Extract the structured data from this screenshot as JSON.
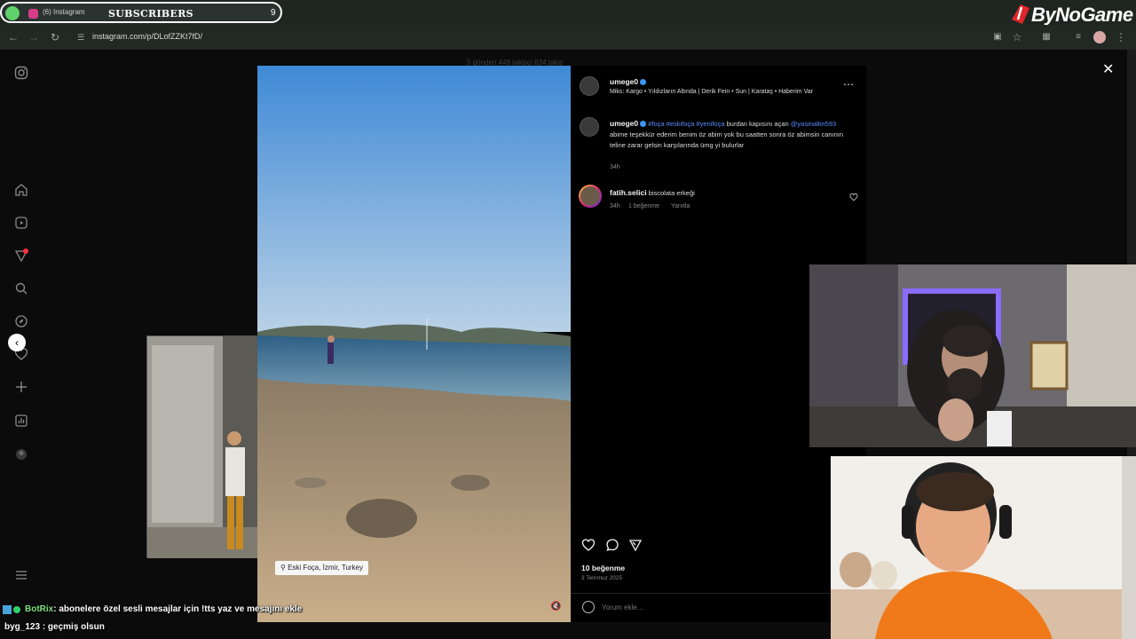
{
  "browser": {
    "tab_title": "(6) Instagram",
    "subscribers_label": "SUBSCRIBERS",
    "subscribers_count": "9",
    "url": "instagram.com/p/DLofZZKt7fD/",
    "brand": "ByNoGame"
  },
  "profile_stats": "5 gönderi   448 takipçi   834 takip",
  "post": {
    "author": "umege0",
    "music": "Miks: Kargo • Yıldızların Altında | Derik Fein • Sun | Karataş • Haberim Var",
    "caption_user": "umege0",
    "caption_tags": "#foça #eskifoça #yenifoça",
    "caption_mention": "@yasinaltin593",
    "caption_text_1": "burdan kapısını açan",
    "caption_text_2": "abime teşekkür ederim benim öz abim yok bu saatten sonra öz abimsin canının teline zarar gelsin karşılarında ümg yi bulurlar",
    "caption_time": "34h",
    "comment_user": "fatih.selici",
    "comment_text": "biscolata erkeği",
    "comment_time": "34h",
    "comment_likes": "1 beğenme",
    "comment_reply": "Yanıtla",
    "likes": "10 beğenme",
    "date": "3 Temmuz 2025",
    "comment_placeholder": "Yorum ekle...",
    "location": "Eski Foça, İzmir, Turkey"
  },
  "chat": [
    {
      "user": "BotRix",
      "message": ": abonelere özel sesli mesajlar için !tts yaz ve mesajını ekle",
      "color": "#ffffff"
    },
    {
      "user": "byg_123",
      "message": ": geçmiş olsun",
      "color": "#ffffff"
    }
  ],
  "colors": {
    "accent": "#3b97f3",
    "brand_red": "#e0262b"
  }
}
